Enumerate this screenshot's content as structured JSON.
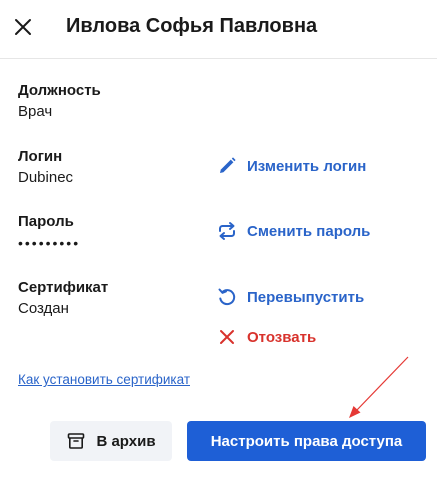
{
  "header": {
    "title": "Ивлова Софья Павловна"
  },
  "fields": {
    "position": {
      "label": "Должность",
      "value": "Врач"
    },
    "login": {
      "label": "Логин",
      "value": "Dubinec"
    },
    "password": {
      "label": "Пароль",
      "value": "•••••••••"
    },
    "certificate": {
      "label": "Сертификат",
      "value": "Создан"
    }
  },
  "actions": {
    "change_login": "Изменить логин",
    "change_password": "Сменить пароль",
    "reissue": "Перевыпустить",
    "revoke": "Отозвать"
  },
  "help_link": "Как установить сертификат",
  "footer": {
    "archive_label": "В архив",
    "access_label": "Настроить права доступа"
  },
  "colors": {
    "accent": "#1e5fd6",
    "link": "#2a64c9",
    "danger": "#d8322c",
    "annotation_arrow": "#e53935"
  },
  "icons": {
    "close": "close-icon",
    "edit": "pencil-icon",
    "change_password": "swap-arrows-icon",
    "reissue": "refresh-icon",
    "revoke": "x-icon",
    "archive": "archive-box-icon"
  }
}
